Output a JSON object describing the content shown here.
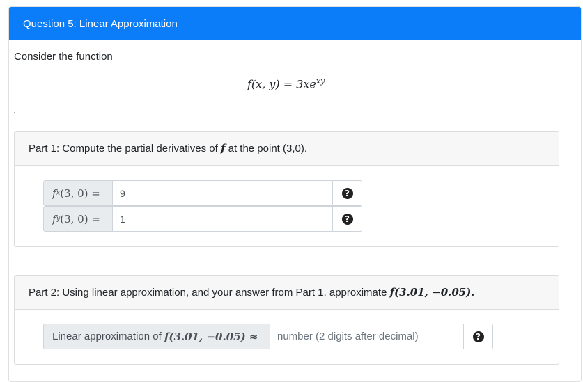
{
  "header": {
    "title": "Question 5: Linear Approximation"
  },
  "intro": {
    "text": "Consider the function"
  },
  "equation": {
    "lhs": "f(x, y) = 3xe",
    "exponent": "xy"
  },
  "trailing_dot": ".",
  "part1": {
    "prompt_pre": "Part 1: Compute the partial derivatives of",
    "prompt_var": "f",
    "prompt_post": "at the point (3,0).",
    "fx": {
      "label_f": "f",
      "label_sub": "x",
      "label_rest": "(3, 0) =",
      "value": "9"
    },
    "fy": {
      "label_f": "f",
      "label_sub": "y",
      "label_rest": "(3, 0) =",
      "value": "1"
    }
  },
  "part2": {
    "prompt_pre": "Part 2: Using linear approximation, and your answer from Part 1, approximate",
    "prompt_math": "f(3.01, −0.05).",
    "label_pre": "Linear approximation of",
    "label_math": "f(3.01, −0.05) ≈",
    "placeholder": "number (2 digits after decimal)"
  },
  "icons": {
    "help": "?"
  },
  "colors": {
    "header_bg": "#0b7df9",
    "header_text": "#ffffff"
  }
}
